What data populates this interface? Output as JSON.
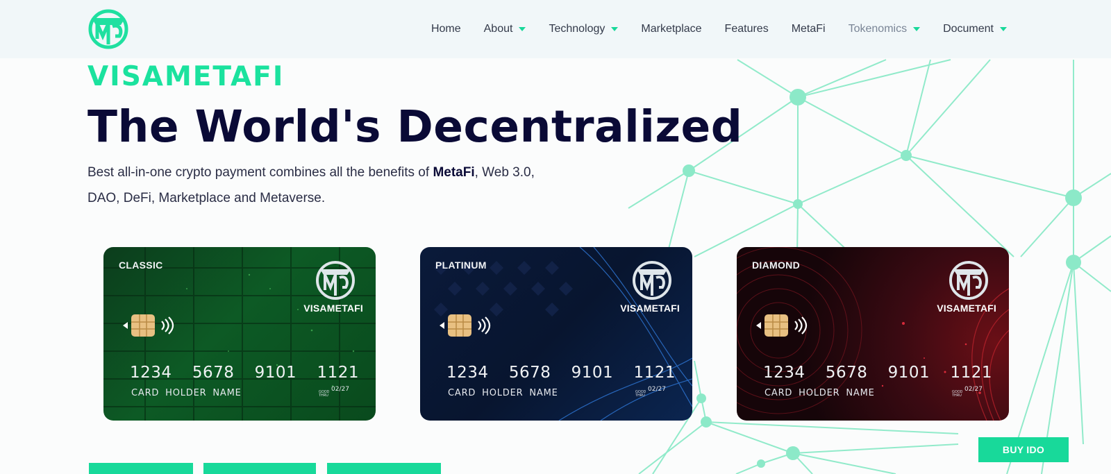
{
  "brand": {
    "name": "VISAMETAFI",
    "logo_icon": "mg-shield-logo"
  },
  "nav": {
    "items": [
      {
        "label": "Home",
        "dropdown": false,
        "muted": false
      },
      {
        "label": "About",
        "dropdown": true,
        "muted": false
      },
      {
        "label": "Technology",
        "dropdown": true,
        "muted": false
      },
      {
        "label": "Marketplace",
        "dropdown": false,
        "muted": false
      },
      {
        "label": "Features",
        "dropdown": false,
        "muted": false
      },
      {
        "label": "MetaFi",
        "dropdown": false,
        "muted": false
      },
      {
        "label": "Tokenomics",
        "dropdown": true,
        "muted": true
      },
      {
        "label": "Document",
        "dropdown": true,
        "muted": false
      }
    ]
  },
  "hero": {
    "eyebrow": "VISAMETAFI",
    "title": "The World's Decentralized",
    "desc_before": "Best all-in-one crypto payment combines all the benefits of ",
    "desc_bold": "MetaFi",
    "desc_after": ", Web 3.0, DAO, DeFi, Marketplace and Metaverse."
  },
  "cards": [
    {
      "tier": "CLASSIC",
      "brand": "VISAMETAFI",
      "numbers": [
        "1234",
        "5678",
        "9101",
        "1121"
      ],
      "holder": "CARD HOLDER NAME",
      "exp_label": "GOOD THRU",
      "exp": "02/27"
    },
    {
      "tier": "PLATINUM",
      "brand": "VISAMETAFI",
      "numbers": [
        "1234",
        "5678",
        "9101",
        "1121"
      ],
      "holder": "CARD HOLDER NAME",
      "exp_label": "GOOD THRU",
      "exp": "02/27"
    },
    {
      "tier": "DIAMOND",
      "brand": "VISAMETAFI",
      "numbers": [
        "1234",
        "5678",
        "9101",
        "1121"
      ],
      "holder": "CARD HOLDER NAME",
      "exp_label": "GOOD THRU",
      "exp": "02/27"
    }
  ],
  "buttons": {
    "buy_ido": "BUY IDO"
  },
  "colors": {
    "accent": "#18d99a",
    "navy": "#0a0a36",
    "header_bg": "#f1f7f9"
  }
}
